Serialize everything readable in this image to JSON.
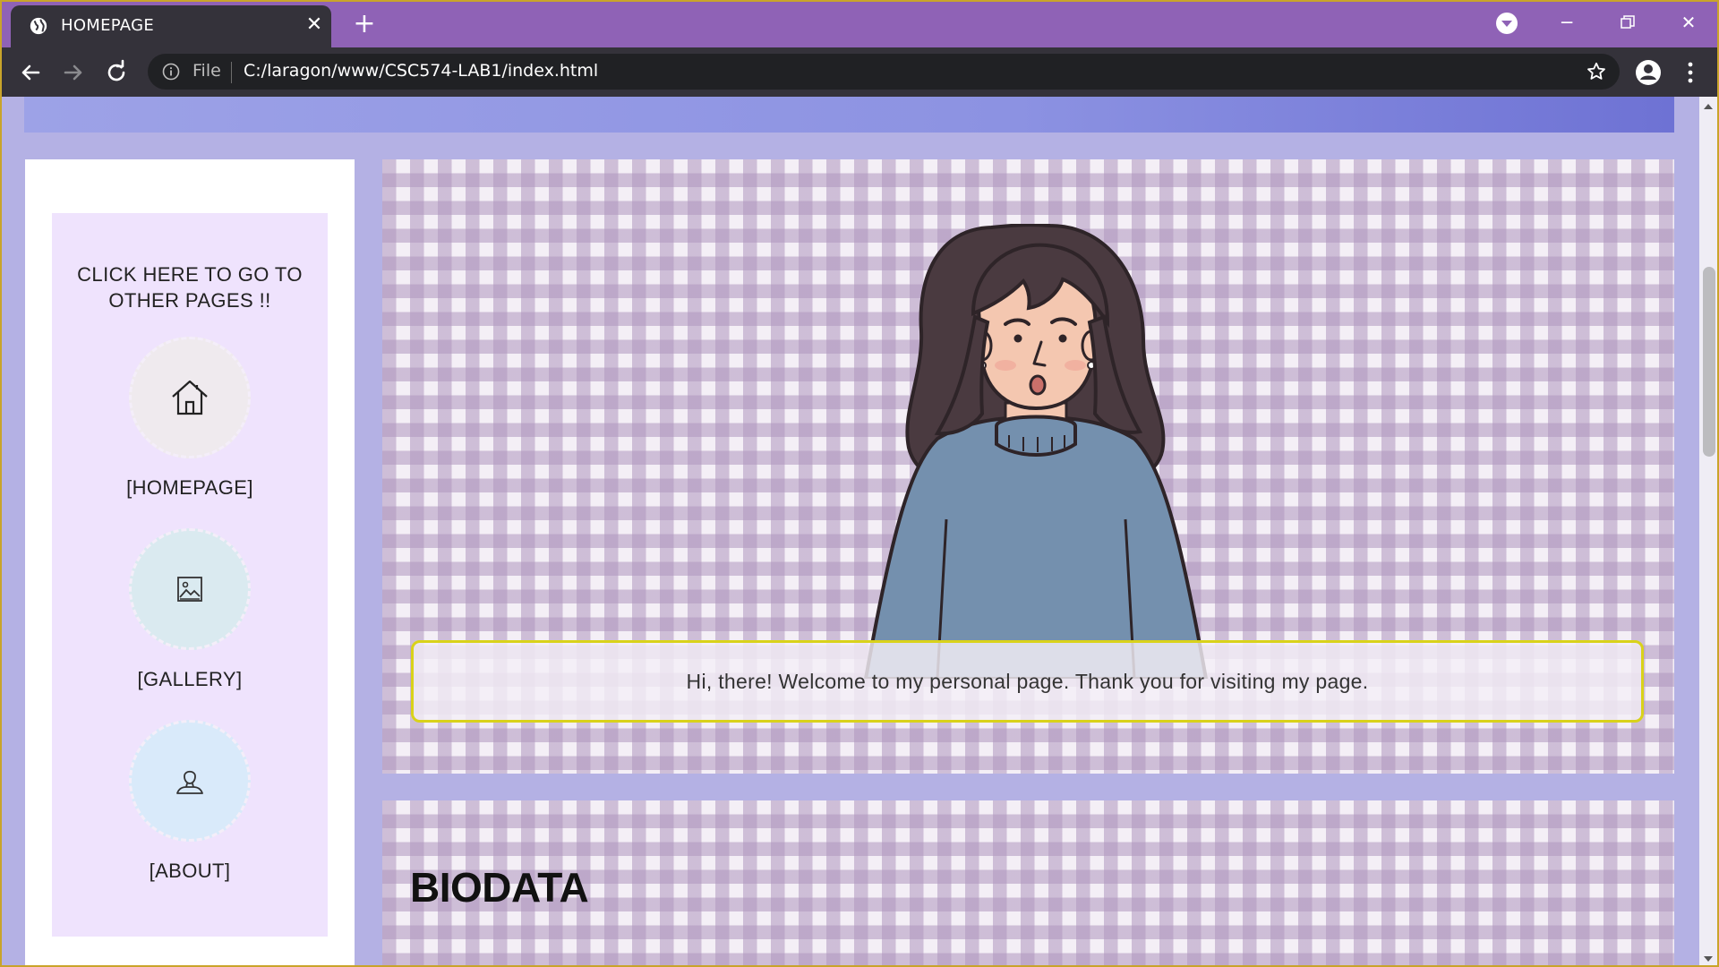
{
  "browser": {
    "tab_title": "HOMEPAGE",
    "address_scheme": "File",
    "url": "C:/laragon/www/CSC574-LAB1/index.html"
  },
  "sidebar": {
    "heading": "CLICK HERE TO GO TO OTHER PAGES !!",
    "items": [
      {
        "label": "[HOMEPAGE]",
        "icon": "home-icon",
        "color": "#efeaee"
      },
      {
        "label": "[GALLERY]",
        "icon": "image-icon",
        "color": "#daeaf0"
      },
      {
        "label": "[ABOUT]",
        "icon": "user-icon",
        "color": "#d9eafa"
      }
    ]
  },
  "main": {
    "welcome_message": "Hi, there! Welcome to my personal page. Thank you for visiting my page.",
    "biodata_title": "BIODATA"
  },
  "colors": {
    "tab_strip": "#8f62b6",
    "page_background": "#b4b1e4",
    "welcome_border": "#d9d21a"
  }
}
